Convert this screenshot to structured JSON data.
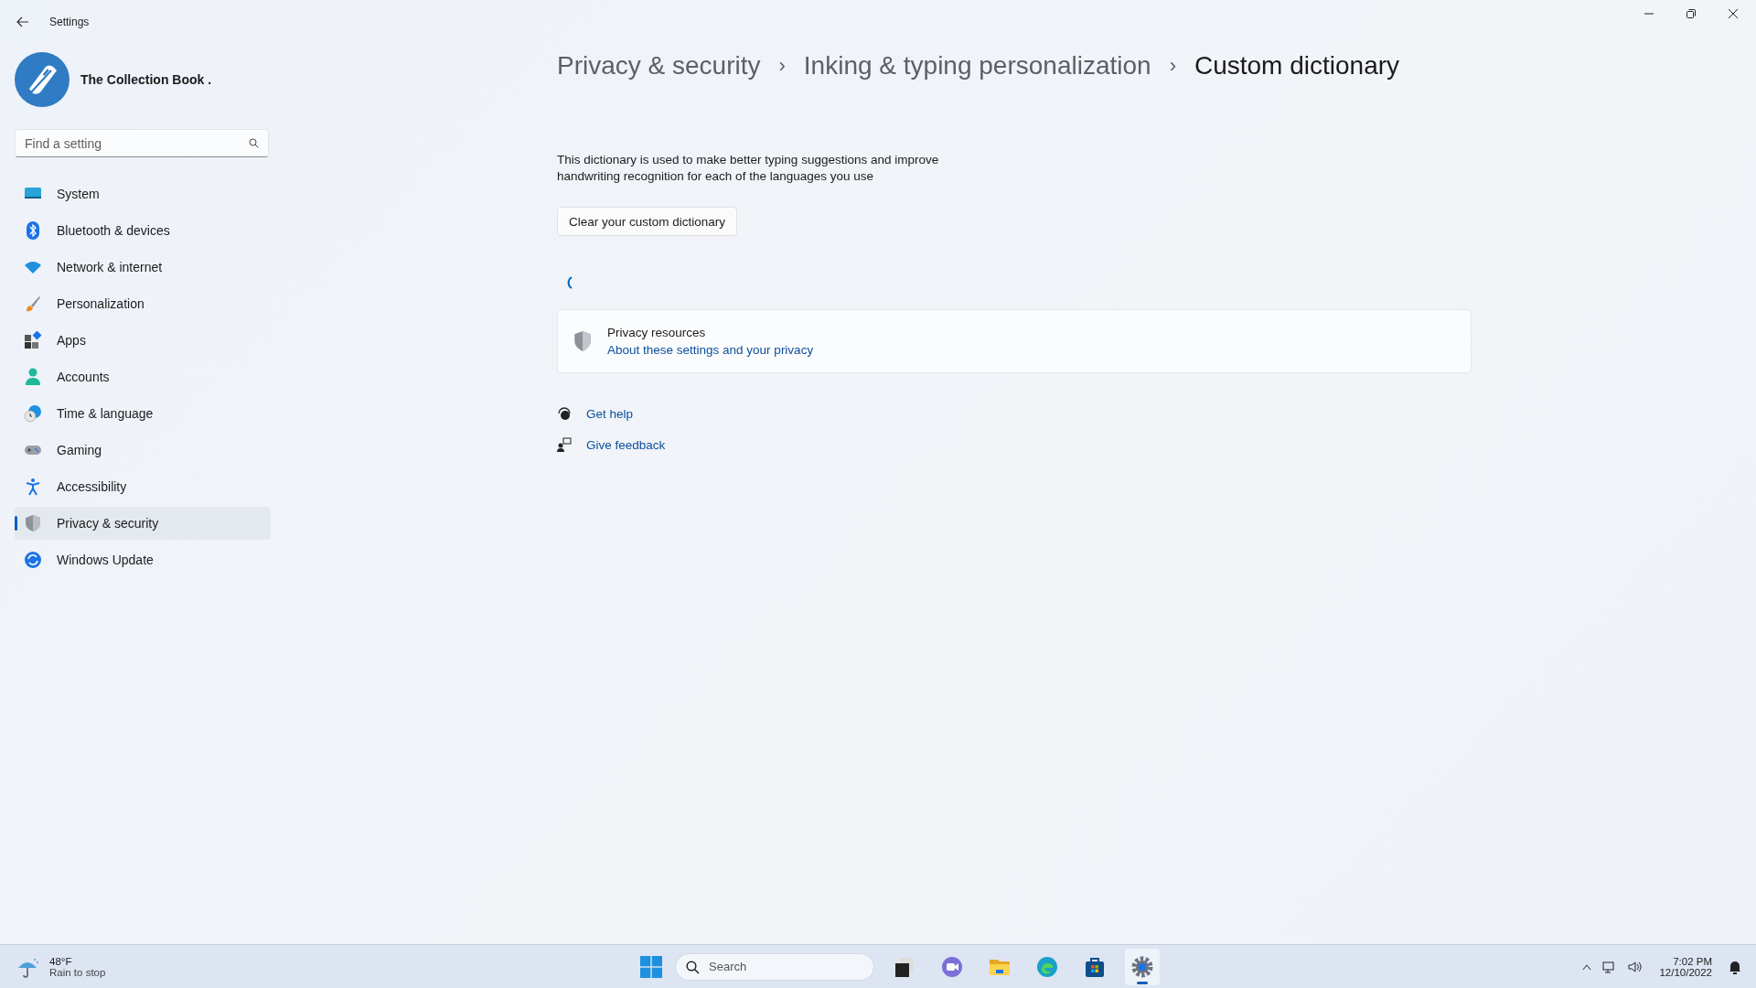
{
  "window": {
    "title": "Settings"
  },
  "profile": {
    "name": "The Collection Book ."
  },
  "search": {
    "placeholder": "Find a setting"
  },
  "nav": [
    {
      "label": "System",
      "kind": "system",
      "selected": false
    },
    {
      "label": "Bluetooth & devices",
      "kind": "bluetooth",
      "selected": false
    },
    {
      "label": "Network & internet",
      "kind": "network",
      "selected": false
    },
    {
      "label": "Personalization",
      "kind": "brush",
      "selected": false
    },
    {
      "label": "Apps",
      "kind": "apps",
      "selected": false
    },
    {
      "label": "Accounts",
      "kind": "accounts",
      "selected": false
    },
    {
      "label": "Time & language",
      "kind": "time",
      "selected": false
    },
    {
      "label": "Gaming",
      "kind": "gaming",
      "selected": false
    },
    {
      "label": "Accessibility",
      "kind": "accessibility",
      "selected": false
    },
    {
      "label": "Privacy & security",
      "kind": "privacy",
      "selected": true
    },
    {
      "label": "Windows Update",
      "kind": "update",
      "selected": false
    }
  ],
  "breadcrumb": [
    {
      "label": "Privacy & security",
      "current": false
    },
    {
      "label": "Inking & typing personalization",
      "current": false
    },
    {
      "label": "Custom dictionary",
      "current": true
    }
  ],
  "breadcrumb_separator": "›",
  "description": "This dictionary is used to make better typing suggestions and improve handwriting recognition for each of the languages you use",
  "clear_button": "Clear your custom dictionary",
  "resources": {
    "title": "Privacy resources",
    "link": "About these settings and your privacy"
  },
  "help_links": [
    {
      "label": "Get help",
      "kind": "help"
    },
    {
      "label": "Give feedback",
      "kind": "feedback"
    }
  ],
  "taskbar": {
    "weather": {
      "temperature": "48°F",
      "condition": "Rain to stop"
    },
    "search_placeholder": "Search",
    "apps": [
      {
        "kind": "taskview",
        "active": false
      },
      {
        "kind": "chat",
        "active": false
      },
      {
        "kind": "explorer",
        "active": false
      },
      {
        "kind": "edge",
        "active": false
      },
      {
        "kind": "store",
        "active": false
      },
      {
        "kind": "settings",
        "active": true
      }
    ],
    "time": "7:02 PM",
    "date": "12/10/2022"
  }
}
